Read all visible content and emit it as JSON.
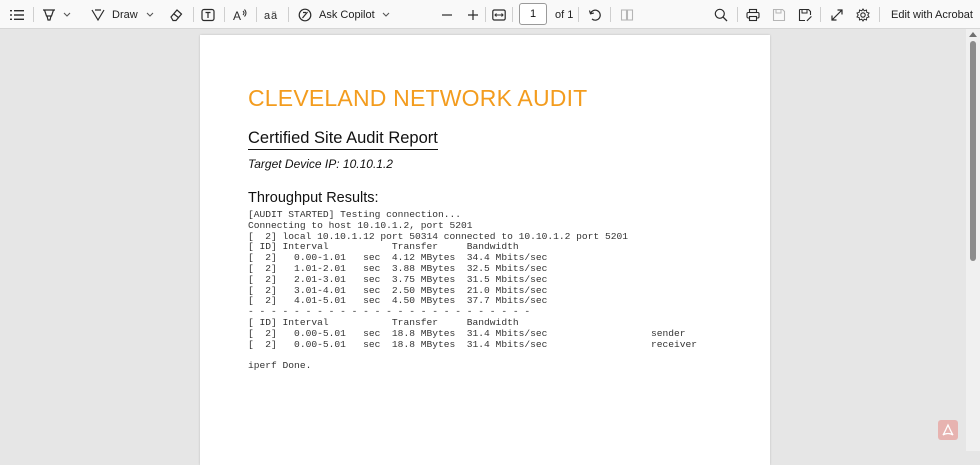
{
  "toolbar": {
    "draw_label": "Draw",
    "ask_copilot_label": "Ask Copilot",
    "page_number": "1",
    "page_total": "of 1",
    "edit_with_acrobat_label": "Edit with Acrobat"
  },
  "icons": {
    "contents": "list-icon",
    "highlight": "highlighter-icon",
    "draw": "pen-icon",
    "erase": "eraser-icon",
    "text_box": "text-box-icon",
    "read_aloud": "read-aloud-icon",
    "translate": "translate-icon",
    "copilot": "copilot-icon",
    "zoom_out": "minus-icon",
    "zoom_in": "plus-icon",
    "fit_page": "fit-width-icon",
    "rotate": "rotate-icon",
    "page_view": "two-page-icon",
    "search": "search-icon",
    "print": "printer-icon",
    "save": "save-icon",
    "save_as": "save-as-icon",
    "fullscreen": "expand-icon",
    "settings": "gear-icon",
    "acrobat": "acrobat-icon"
  },
  "document": {
    "title": "CLEVELAND NETWORK AUDIT",
    "subtitle": "Certified Site Audit Report",
    "target_ip": "Target Device IP: 10.10.1.2",
    "section_heading": "Throughput Results:",
    "console_output": "[AUDIT STARTED] Testing connection...\nConnecting to host 10.10.1.2, port 5201\n[  2] local 10.10.1.12 port 50314 connected to 10.10.1.2 port 5201\n[ ID] Interval           Transfer     Bandwidth\n[  2]   0.00-1.01   sec  4.12 MBytes  34.4 Mbits/sec\n[  2]   1.01-2.01   sec  3.88 MBytes  32.5 Mbits/sec\n[  2]   2.01-3.01   sec  3.75 MBytes  31.5 Mbits/sec\n[  2]   3.01-4.01   sec  2.50 MBytes  21.0 Mbits/sec\n[  2]   4.01-5.01   sec  4.50 MBytes  37.7 Mbits/sec\n- - - - - - - - - - - - - - - - - - - - - - - - -\n[ ID] Interval           Transfer     Bandwidth\n[  2]   0.00-5.01   sec  18.8 MBytes  31.4 Mbits/sec                  sender\n[  2]   0.00-5.01   sec  18.8 MBytes  31.4 Mbits/sec                  receiver\n\niperf Done."
  },
  "colors": {
    "title_accent": "#f39c1e",
    "toolbar_bg": "#f9f9f9",
    "viewer_bg": "#e6e6e6"
  }
}
